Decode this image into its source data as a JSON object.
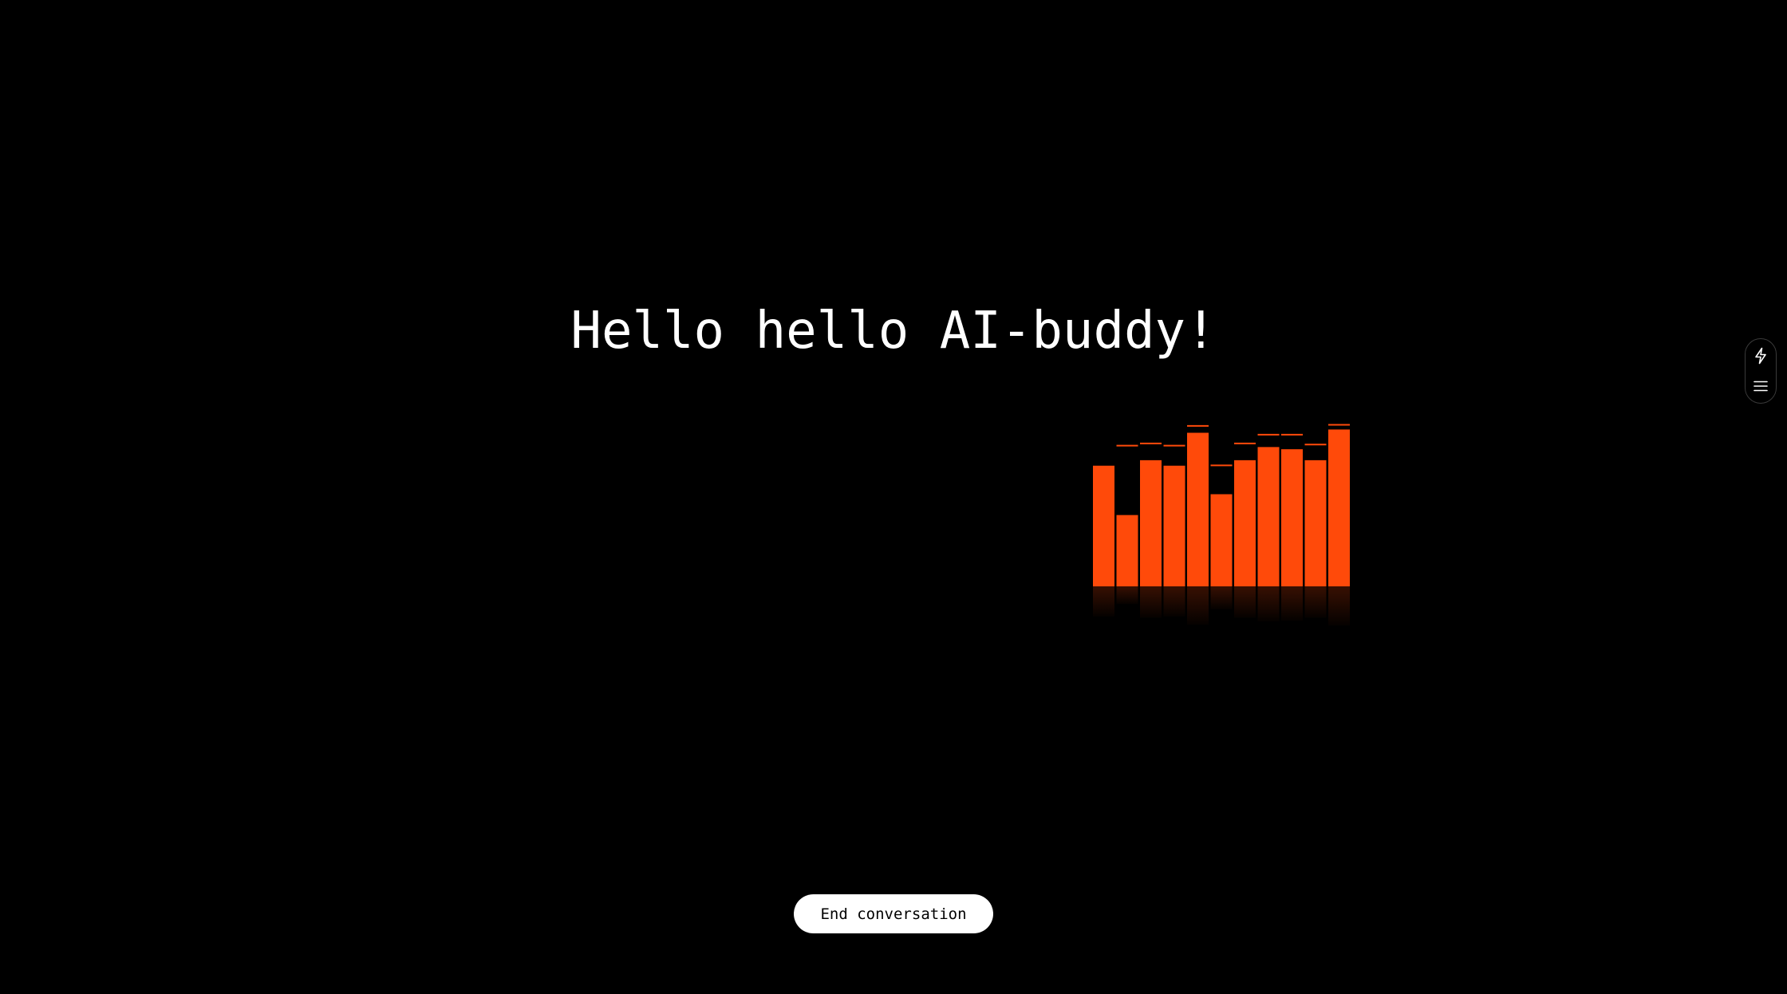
{
  "greeting": "Hello hello AI-buddy!",
  "end_button_label": "End conversation",
  "side_toolbar": {
    "items": [
      {
        "icon": "lightning-icon"
      },
      {
        "icon": "menu-icon"
      }
    ]
  },
  "visualizer": {
    "bar_color": "#ff4a0a",
    "levels": [
      0.55,
      0.325,
      0.575,
      0.55,
      0.7,
      0.42,
      0.575,
      0.635,
      0.625,
      0.575,
      0.715
    ],
    "peaks": [
      null,
      0.645,
      0.655,
      0.645,
      0.735,
      0.555,
      0.655,
      0.695,
      0.695,
      0.65,
      0.74
    ]
  }
}
